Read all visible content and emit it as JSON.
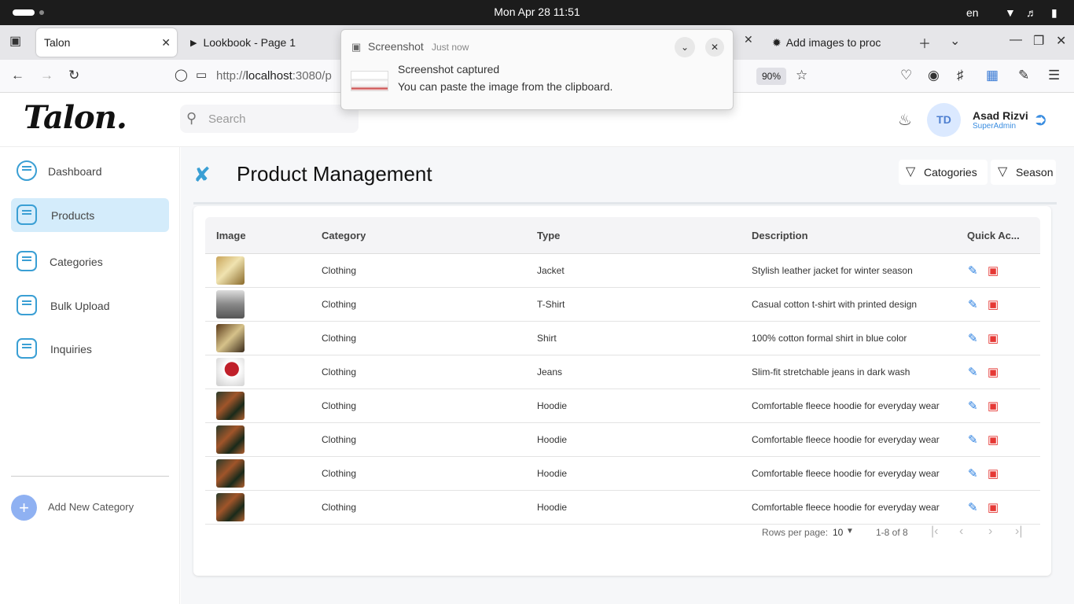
{
  "os": {
    "clock": "Mon Apr 28  11:51",
    "lang": "en"
  },
  "browser": {
    "tabs": [
      {
        "label": "Talon",
        "active": true
      },
      {
        "label": "Lookbook - Page 1"
      },
      {
        "label": "Add images to proc"
      }
    ],
    "url_prefix": "http://",
    "url_host": "localhost",
    "url_rest": ":3080/p",
    "zoom": "90%"
  },
  "notification": {
    "app": "Screenshot",
    "time": "Just now",
    "title": "Screenshot captured",
    "body": "You can paste the image from the clipboard."
  },
  "header": {
    "logo": "Talon.",
    "search_placeholder": "Search",
    "avatar_initials": "TD",
    "user_name": "Asad Rizvi",
    "user_role": "SuperAdmin"
  },
  "sidebar": {
    "items": [
      {
        "label": "Dashboard"
      },
      {
        "label": "Products",
        "active": true
      },
      {
        "label": "Categories"
      },
      {
        "label": "Bulk Upload"
      },
      {
        "label": "Inquiries"
      }
    ],
    "add_label": "Add New Category"
  },
  "main": {
    "title": "Product Management",
    "filters": [
      "Catogories",
      "Season"
    ],
    "columns": [
      "Image",
      "Category",
      "Type",
      "Description",
      "Quick Ac..."
    ],
    "rows": [
      {
        "category": "Clothing",
        "type": "Jacket",
        "description": "Stylish leather jacket for winter season"
      },
      {
        "category": "Clothing",
        "type": "T-Shirt",
        "description": "Casual cotton t-shirt with printed design"
      },
      {
        "category": "Clothing",
        "type": "Shirt",
        "description": "100% cotton formal shirt in blue color"
      },
      {
        "category": "Clothing",
        "type": "Jeans",
        "description": "Slim-fit stretchable jeans in dark wash"
      },
      {
        "category": "Clothing",
        "type": "Hoodie",
        "description": "Comfortable fleece hoodie for everyday wear"
      },
      {
        "category": "Clothing",
        "type": "Hoodie",
        "description": "Comfortable fleece hoodie for everyday wear"
      },
      {
        "category": "Clothing",
        "type": "Hoodie",
        "description": "Comfortable fleece hoodie for everyday wear"
      },
      {
        "category": "Clothing",
        "type": "Hoodie",
        "description": "Comfortable fleece hoodie for everyday wear"
      }
    ],
    "pagination": {
      "rows_per_page_label": "Rows per page:",
      "rows_per_page": "10",
      "range": "1-8 of 8"
    }
  },
  "colors": {
    "accent": "#3a9fd4",
    "edit": "#2a7fe0",
    "delete": "#e53935",
    "active_bg": "#d4ecfb"
  }
}
